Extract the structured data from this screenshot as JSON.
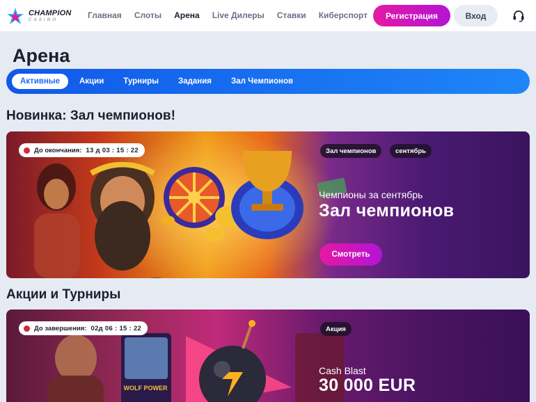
{
  "header": {
    "logo_main": "CHAMPION",
    "logo_sub": "CASINO",
    "nav": [
      "Главная",
      "Слоты",
      "Арена",
      "Live Дилеры",
      "Ставки",
      "Киберспорт"
    ],
    "active_nav": "Арена",
    "register_label": "Регистрация",
    "login_label": "Вход"
  },
  "page": {
    "title": "Арена"
  },
  "tabs": [
    "Активные",
    "Акции",
    "Турниры",
    "Задания",
    "Зал Чемпионов"
  ],
  "sections": {
    "new_title": "Новинка: Зал чемпионов!",
    "promos_title": "Акции и Турниры"
  },
  "banner1": {
    "timer_label": "До окончания:",
    "timer_value": "13 д  03 : 15 : 22",
    "tags": [
      "Зал чемпионов",
      "сентябрь"
    ],
    "subtitle": "Чемпионы за сентябрь",
    "title": "Зал чемпионов",
    "button_label": "Смотреть"
  },
  "banner2": {
    "timer_label": "До завершения:",
    "timer_value": "02д 06 : 15 : 22",
    "tag": "Акция",
    "subtitle": "Cash Blast",
    "title": "30 000 EUR"
  },
  "colors": {
    "accent_blue": "#1b6ef3",
    "brand_pink": "#e41aa3",
    "timer_dot": "#d3293b"
  },
  "icons": [
    "logo-star-icon",
    "headset-icon",
    "red-dot-icon"
  ]
}
